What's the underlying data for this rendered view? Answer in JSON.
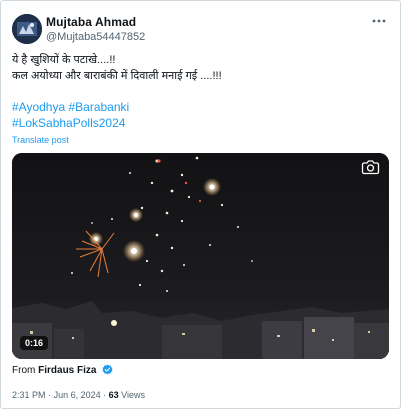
{
  "author": {
    "name": "Mujtaba Ahmad",
    "handle": "@Mujtaba54447852"
  },
  "post": {
    "line1": "ये है खुशियों के पटाखे....!!",
    "line2": "कल अयोध्या और बाराबंकी में दिवाली मनाई गई  ....!!!",
    "hashtags_line1": "#Ayodhya #Barabanki",
    "hashtags_line2": "#LokSabhaPolls2024",
    "translate_label": "Translate post"
  },
  "video": {
    "duration": "0:16",
    "description_icon": "camera-icon"
  },
  "source": {
    "from_label": "From",
    "name": "Firdaus Fiza"
  },
  "meta": {
    "time": "2:31 PM",
    "date": "Jun 6, 2024",
    "separator": "·",
    "views_count": "63",
    "views_label": "Views"
  },
  "colors": {
    "link": "#1d9bf0",
    "secondary": "#536471",
    "primary": "#0f1419"
  }
}
